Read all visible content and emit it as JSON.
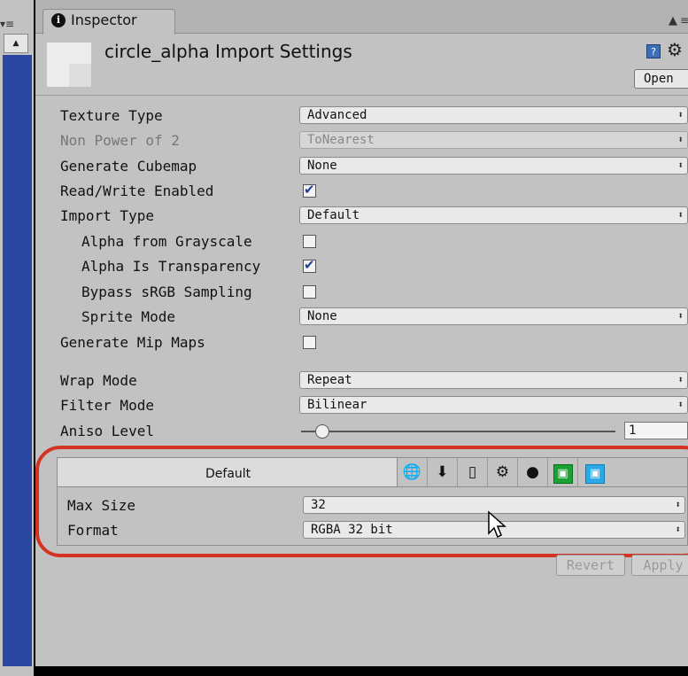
{
  "window": {
    "tab_label": "Inspector",
    "tab_info_glyph": "i"
  },
  "header": {
    "title": "circle_alpha Import Settings",
    "open_label": "Open",
    "help_glyph": "?"
  },
  "properties": [
    {
      "label": "Texture Type",
      "control": "dropdown",
      "value": "Advanced",
      "indent": false,
      "disabled": false
    },
    {
      "label": "Non Power of 2",
      "control": "dropdown",
      "value": "ToNearest",
      "indent": false,
      "disabled": true
    },
    {
      "label": "Generate Cubemap",
      "control": "dropdown",
      "value": "None",
      "indent": false,
      "disabled": false
    },
    {
      "label": "Read/Write Enabled",
      "control": "checkbox",
      "checked": true,
      "indent": false
    },
    {
      "label": "Import Type",
      "control": "dropdown",
      "value": "Default",
      "indent": false,
      "disabled": false
    },
    {
      "label": "Alpha from Grayscale",
      "control": "checkbox",
      "checked": false,
      "indent": true
    },
    {
      "label": "Alpha Is Transparency",
      "control": "checkbox",
      "checked": true,
      "indent": true
    },
    {
      "label": "Bypass sRGB Sampling",
      "control": "checkbox",
      "checked": false,
      "indent": true
    },
    {
      "label": "Sprite Mode",
      "control": "dropdown",
      "value": "None",
      "indent": true,
      "disabled": false
    },
    {
      "label": "Generate Mip Maps",
      "control": "checkbox",
      "checked": false,
      "indent": false
    },
    {
      "label": "Wrap Mode",
      "control": "dropdown",
      "value": "Repeat",
      "indent": false,
      "disabled": false
    },
    {
      "label": "Filter Mode",
      "control": "dropdown",
      "value": "Bilinear",
      "indent": false,
      "disabled": false
    }
  ],
  "aniso": {
    "label": "Aniso Level",
    "value": "1",
    "slider_level": 0.0
  },
  "platform": {
    "default_tab": "Default",
    "icons": [
      "globe-icon",
      "download-icon",
      "mobile-icon",
      "android-icon",
      "blackberry-icon",
      "windows-store-icon",
      "windows-phone-icon"
    ],
    "max_size_label": "Max Size",
    "max_size_value": "32",
    "format_label": "Format",
    "format_value": "RGBA 32 bit"
  },
  "buttons": {
    "revert": "Revert",
    "apply": "Apply"
  },
  "glyphs": {
    "dropdown_arrow": "⬍",
    "check": "✔",
    "lock": "🔒",
    "menu": "▾≡",
    "gear": "⚙"
  },
  "colors": {
    "panel_bg": "#c2c2c2",
    "sidebar_blue": "#2a46a0",
    "highlight_outline": "#d33320",
    "check_blue": "#1d3f9a"
  }
}
